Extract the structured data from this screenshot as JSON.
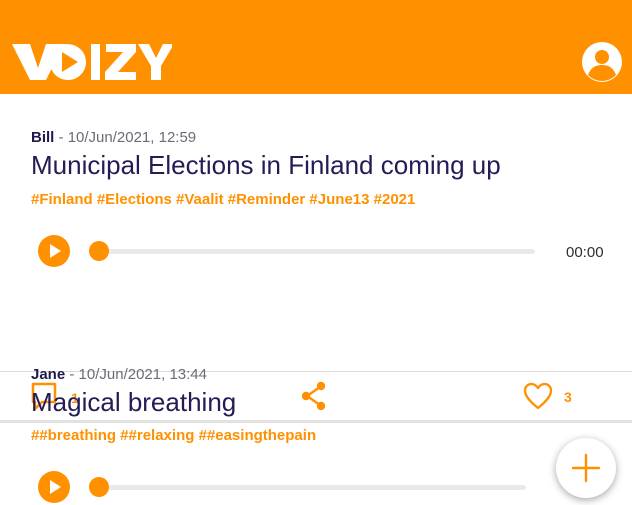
{
  "app": {
    "logo_text": "VOIZY",
    "accent_color": "#ff9100",
    "icons": {
      "profile": "user-avatar-icon",
      "play": "play-icon",
      "comment": "comment-bubble-icon",
      "share": "share-icon",
      "like": "heart-icon",
      "add": "plus-icon"
    }
  },
  "posts": [
    {
      "author": "Bill",
      "separator": " - ",
      "timestamp": "10/Jun/2021, 12:59",
      "title": "Municipal Elections in Finland coming up",
      "tags": "#Finland #Elections #Vaalit #Reminder #June13 #2021",
      "progress": 0,
      "time": "00:00",
      "comments_count": "1",
      "likes_count": "3"
    },
    {
      "author": "Jane",
      "separator": " - ",
      "timestamp": "10/Jun/2021, 13:44",
      "title": "Magical breathing",
      "tags": "##breathing ##relaxing ##easingthepain",
      "progress": 0
    }
  ]
}
